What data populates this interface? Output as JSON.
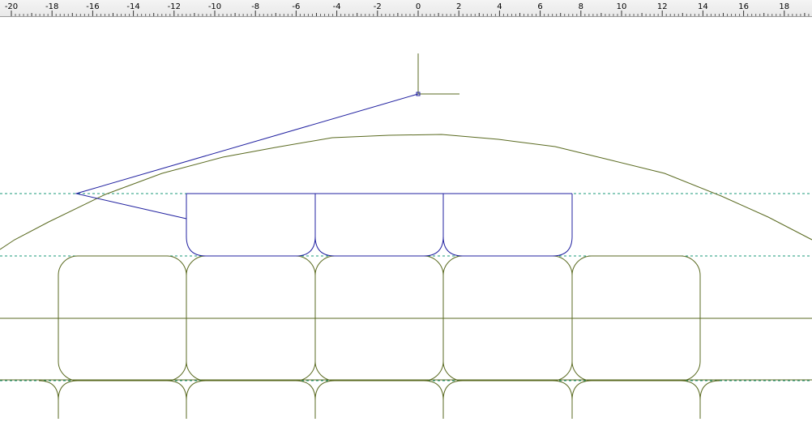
{
  "ruler": {
    "labels": [
      "-20",
      "-18",
      "-16",
      "-14",
      "-12",
      "-10",
      "-8",
      "-6",
      "-4",
      "-2",
      "0",
      "2",
      "4",
      "6",
      "8",
      "10",
      "12",
      "14",
      "16",
      "18"
    ]
  },
  "colors": {
    "background": "#ffffff",
    "ruler_bg": "#ececec",
    "olive_geometry": "#5a6a20",
    "blue_selection": "#2020a0",
    "guide_dashed": "#1a9a7a"
  },
  "drawing": {
    "elements": [
      {
        "name": "origin-axis-vertical",
        "kind": "line",
        "color": "olive"
      },
      {
        "name": "origin-axis-horizontal",
        "kind": "line",
        "color": "olive"
      },
      {
        "name": "origin-marker",
        "kind": "point",
        "color": "blue"
      },
      {
        "name": "arch-curve",
        "kind": "polyline",
        "color": "olive"
      },
      {
        "name": "selected-polyline",
        "kind": "polyline",
        "color": "blue"
      },
      {
        "name": "horizontal-guides",
        "kind": "dashed-lines",
        "count": 3
      },
      {
        "name": "rounded-cells-grid",
        "kind": "rounded-rects",
        "rows": 2,
        "cols": 5
      }
    ]
  }
}
